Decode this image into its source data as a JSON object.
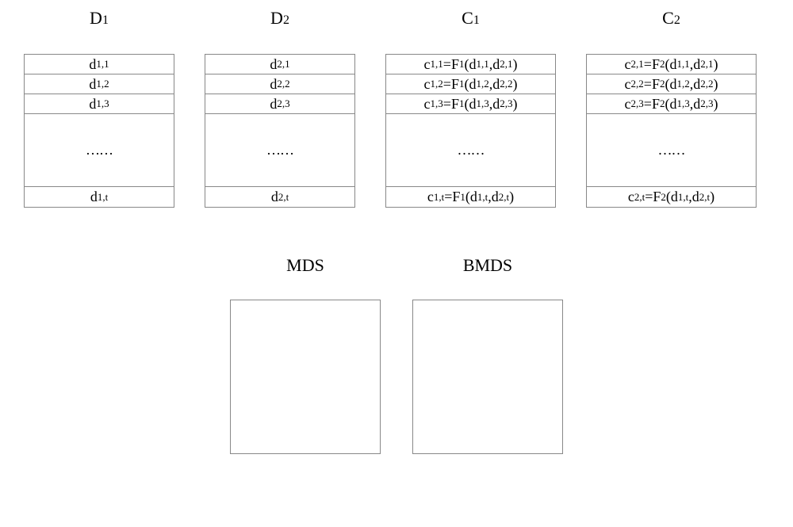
{
  "columns": {
    "d1": {
      "header_main": "D",
      "header_sub": "1",
      "rows": [
        {
          "main": "d",
          "sub": "1,1"
        },
        {
          "main": "d",
          "sub": "1,2"
        },
        {
          "main": "d",
          "sub": "1,3"
        }
      ],
      "ellipsis": "……",
      "last": {
        "main": "d",
        "sub": "1,t"
      }
    },
    "d2": {
      "header_main": "D",
      "header_sub": "2",
      "rows": [
        {
          "main": "d",
          "sub": "2,1"
        },
        {
          "main": "d",
          "sub": "2,2"
        },
        {
          "main": "d",
          "sub": "2,3"
        }
      ],
      "ellipsis": "……",
      "last": {
        "main": "d",
        "sub": "2,t"
      }
    },
    "c1": {
      "header_main": "C",
      "header_sub": "1",
      "rows": [
        {
          "lhs_main": "c",
          "lhs_sub": "1,1",
          "fn_main": "F",
          "fn_sub": "1",
          "a1_main": "d",
          "a1_sub": "1,1",
          "a2_main": "d",
          "a2_sub": "2,1"
        },
        {
          "lhs_main": "c",
          "lhs_sub": "1,2",
          "fn_main": "F",
          "fn_sub": "1",
          "a1_main": "d",
          "a1_sub": "1,2",
          "a2_main": "d",
          "a2_sub": "2,2"
        },
        {
          "lhs_main": "c",
          "lhs_sub": "1,3",
          "fn_main": "F",
          "fn_sub": "1",
          "a1_main": "d",
          "a1_sub": "1,3",
          "a2_main": "d",
          "a2_sub": "2,3"
        }
      ],
      "ellipsis": "……",
      "last": {
        "lhs_main": "c",
        "lhs_sub": "1,t",
        "fn_main": "F",
        "fn_sub": "1",
        "a1_main": "d",
        "a1_sub": "1,t",
        "a2_main": "d",
        "a2_sub": "2,t"
      }
    },
    "c2": {
      "header_main": "C",
      "header_sub": "2",
      "rows": [
        {
          "lhs_main": "c",
          "lhs_sub": "2,1",
          "fn_main": "F",
          "fn_sub": "2",
          "a1_main": "d",
          "a1_sub": "1,1",
          "a2_main": "d",
          "a2_sub": "2,1"
        },
        {
          "lhs_main": "c",
          "lhs_sub": "2,2",
          "fn_main": "F",
          "fn_sub": "2",
          "a1_main": "d",
          "a1_sub": "1,2",
          "a2_main": "d",
          "a2_sub": "2,2"
        },
        {
          "lhs_main": "c",
          "lhs_sub": "2,3",
          "fn_main": "F",
          "fn_sub": "2",
          "a1_main": "d",
          "a1_sub": "1,3",
          "a2_main": "d",
          "a2_sub": "2,3"
        }
      ],
      "ellipsis": "……",
      "last": {
        "lhs_main": "c",
        "lhs_sub": "2,t",
        "fn_main": "F",
        "fn_sub": "2",
        "a1_main": "d",
        "a1_sub": "1,t",
        "a2_main": "d",
        "a2_sub": "2,t"
      }
    }
  },
  "bottom": {
    "mds_label": "MDS",
    "bmds_label": "BMDS"
  }
}
